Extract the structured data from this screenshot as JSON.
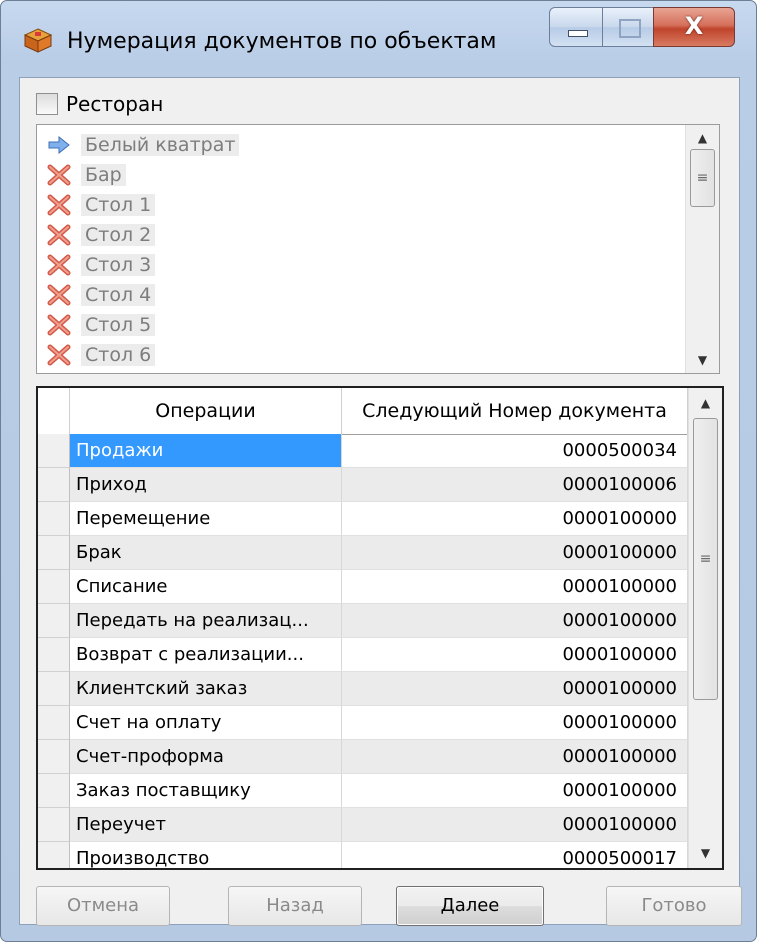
{
  "window": {
    "title": "Нумерация документов по объектам",
    "close_glyph": "X"
  },
  "restaurant_checkbox": {
    "label": "Ресторан",
    "checked": false
  },
  "objects": [
    {
      "label": "Белый кватрат",
      "icon": "arrow-right-icon"
    },
    {
      "label": "Бар",
      "icon": "cross-icon"
    },
    {
      "label": "Стол 1",
      "icon": "cross-icon"
    },
    {
      "label": "Стол 2",
      "icon": "cross-icon"
    },
    {
      "label": "Стол 3",
      "icon": "cross-icon"
    },
    {
      "label": "Стол 4",
      "icon": "cross-icon"
    },
    {
      "label": "Стол 5",
      "icon": "cross-icon"
    },
    {
      "label": "Стол 6",
      "icon": "cross-icon"
    }
  ],
  "grid": {
    "columns": [
      "Операции",
      "Следующий Номер документа"
    ],
    "rows": [
      {
        "operation": "Продажи",
        "number": "0000500034",
        "selected": true
      },
      {
        "operation": "Приход",
        "number": "0000100006"
      },
      {
        "operation": "Перемещение",
        "number": "0000100000"
      },
      {
        "operation": "Брак",
        "number": "0000100000"
      },
      {
        "operation": "Списание",
        "number": "0000100000"
      },
      {
        "operation": "Передать на реализац...",
        "number": "0000100000"
      },
      {
        "operation": "Возврат с реализации...",
        "number": "0000100000"
      },
      {
        "operation": "Клиентский заказ",
        "number": "0000100000"
      },
      {
        "operation": "Счет на оплату",
        "number": "0000100000"
      },
      {
        "operation": "Счет-проформа",
        "number": "0000100000"
      },
      {
        "operation": "Заказ поставщику",
        "number": "0000100000"
      },
      {
        "operation": "Переучет",
        "number": "0000100000"
      },
      {
        "operation": "Производство",
        "number": "0000500017"
      }
    ]
  },
  "buttons": {
    "cancel": "Отмена",
    "back": "Назад",
    "next": "Далее",
    "finish": "Готово"
  },
  "colors": {
    "selection": "#3399ff",
    "title_bar": "#b9cde7",
    "cross_icon": "#cc4433",
    "arrow_icon": "#5b8fd6"
  }
}
